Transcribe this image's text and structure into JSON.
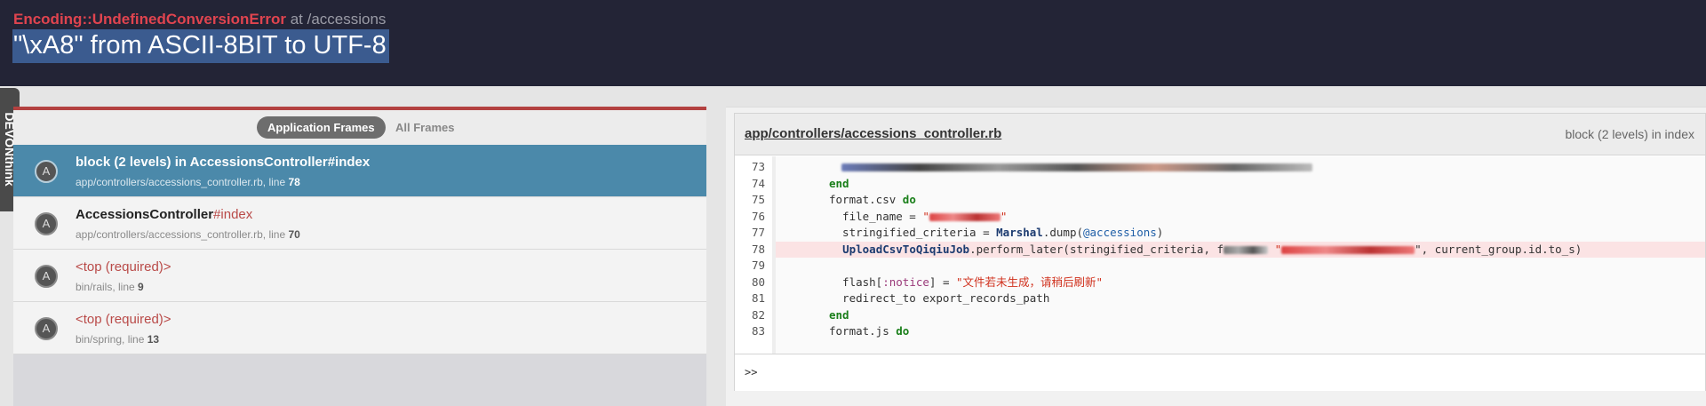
{
  "error": {
    "class_name": "Encoding::UndefinedConversionError",
    "location": "at /accessions",
    "message": "\"\\xA8\" from ASCII-8BIT to UTF-8"
  },
  "side_tab": {
    "label": "DEVONthink"
  },
  "frames_tabs": {
    "application": "Application Frames",
    "all": "All Frames"
  },
  "frames": [
    {
      "avatar": "A",
      "title_main": "block (2 levels) in AccessionsController",
      "title_method": "#index",
      "path": "app/controllers/accessions_controller.rb, line ",
      "line": "78",
      "selected": true
    },
    {
      "avatar": "A",
      "title_main": "AccessionsController",
      "title_method": "#index",
      "path": "app/controllers/accessions_controller.rb, line ",
      "line": "70",
      "selected": false
    },
    {
      "avatar": "A",
      "title_main": "<top (required)>",
      "title_method": "",
      "path": "bin/rails, line ",
      "line": "9",
      "selected": false
    },
    {
      "avatar": "A",
      "title_main": "<top (required)>",
      "title_method": "",
      "path": "bin/spring, line ",
      "line": "13",
      "selected": false
    }
  ],
  "code": {
    "file": "app/controllers/accessions_controller.rb",
    "frame_label": "block (2 levels) in index",
    "lines": [
      {
        "n": "73",
        "indent": "  ",
        "pre": "",
        "post": ""
      },
      {
        "n": "74",
        "text": "end"
      },
      {
        "n": "75",
        "pre": "format.csv ",
        "kw": "do"
      },
      {
        "n": "76",
        "pre": "  file_name = ",
        "str": "\"",
        "str_end": "\""
      },
      {
        "n": "77",
        "pre": "  stringified_criteria = ",
        "const": "Marshal",
        "mid": ".dump(",
        "ivar": "@accessions",
        "post": ")"
      },
      {
        "n": "78",
        "const": "UploadCsvToQiqiuJob",
        "mid": ".perform_later(stringified_criteria, f",
        "post": "\", current_group.id.to_s)"
      },
      {
        "n": "79"
      },
      {
        "n": "80",
        "pre": "  flash[",
        "sym": ":notice",
        "mid": "] = ",
        "str": "\"文件若未生成，请稍后刷新\""
      },
      {
        "n": "81",
        "pre": "  redirect_to export_records_path"
      },
      {
        "n": "82",
        "text": "end"
      },
      {
        "n": "83",
        "pre": "format.js ",
        "kw": "do"
      }
    ]
  },
  "repl": {
    "prompt": ">>"
  }
}
